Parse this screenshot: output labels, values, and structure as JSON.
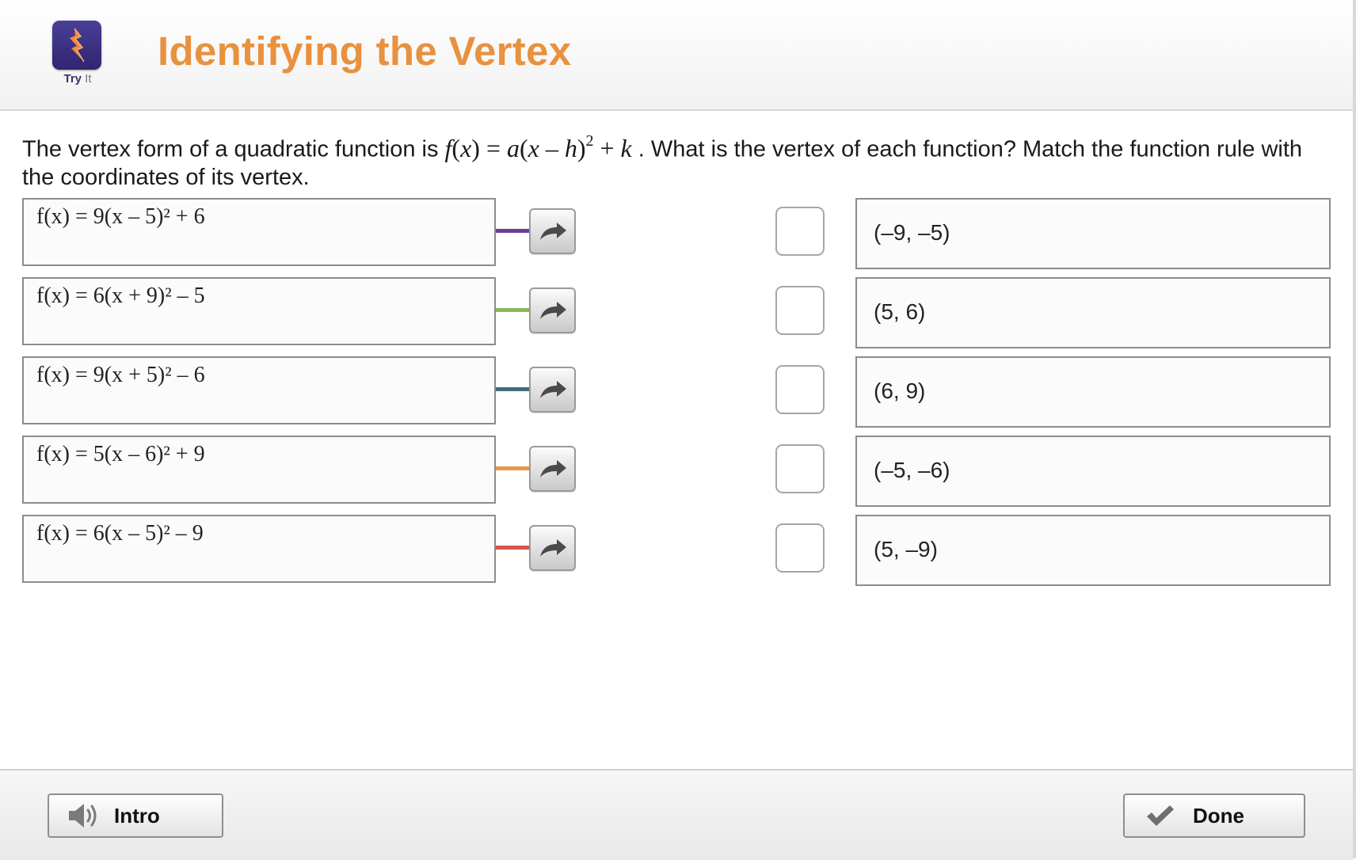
{
  "header": {
    "logo_caption_bold": "Try",
    "logo_caption_light": "It",
    "title": "Identifying the Vertex"
  },
  "prompt": {
    "before": "The vertex form of a quadratic function is ",
    "f": "f",
    "x_open": "(",
    "x": "x",
    "x_close": ") = ",
    "a": "a",
    "paren": "(",
    "x2": "x",
    "minus": " – ",
    "h": "h",
    "paren_close": ")",
    "exp": "2",
    "plus": " + ",
    "k": "k",
    "after": " . What is the vertex of each function? Match the function rule with the coordinates of its vertex."
  },
  "functions": [
    {
      "text": "f(x) = 9(x – 5)² + 6",
      "line_color": "#6a3d96"
    },
    {
      "text": "f(x) = 6(x + 9)² – 5",
      "line_color": "#8db85a"
    },
    {
      "text": "f(x) = 9(x + 5)² – 6",
      "line_color": "#3f6f78"
    },
    {
      "text": "f(x) = 5(x – 6)² + 9",
      "line_color": "#e59a48"
    },
    {
      "text": "f(x) = 6(x – 5)² – 9",
      "line_color": "#d1574a"
    }
  ],
  "vertices": [
    "(–9, –5)",
    "(5, 6)",
    "(6, 9)",
    "(–5, –6)",
    "(5, –9)"
  ],
  "footer": {
    "intro_label": "Intro",
    "done_label": "Done"
  },
  "icons": {
    "logo": "lightning-bolt-icon",
    "arrow": "curved-arrow-right-icon",
    "speaker": "speaker-icon",
    "check": "checkmark-icon"
  }
}
